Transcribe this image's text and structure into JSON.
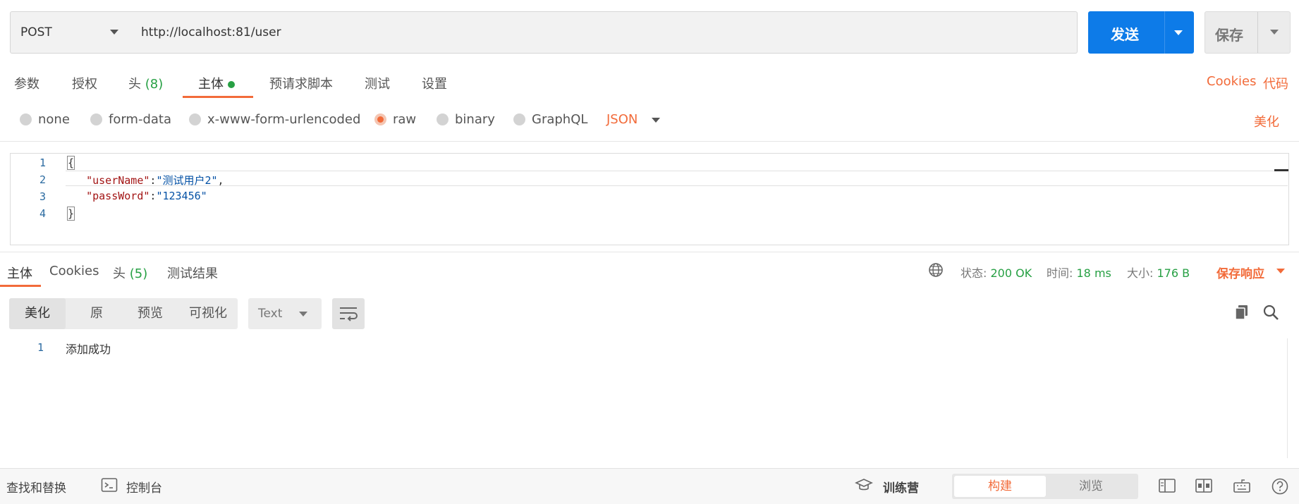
{
  "request": {
    "method": "POST",
    "url": "http://localhost:81/user",
    "send_label": "发送",
    "save_label": "保存"
  },
  "request_tabs": [
    {
      "label": "参数"
    },
    {
      "label": "授权"
    },
    {
      "label": "头",
      "count": "(8)"
    },
    {
      "label": "主体",
      "active": true
    },
    {
      "label": "预请求脚本"
    },
    {
      "label": "测试"
    },
    {
      "label": "设置"
    }
  ],
  "request_links": {
    "cookies": "Cookies",
    "code": "代码"
  },
  "body_types": [
    {
      "label": "none",
      "selected": false
    },
    {
      "label": "form-data",
      "selected": false
    },
    {
      "label": "x-www-form-urlencoded",
      "selected": false
    },
    {
      "label": "raw",
      "selected": true
    },
    {
      "label": "binary",
      "selected": false
    },
    {
      "label": "GraphQL",
      "selected": false
    }
  ],
  "body_language": "JSON",
  "beautify_label": "美化",
  "editor": {
    "line_numbers": [
      "1",
      "2",
      "3",
      "4"
    ],
    "open_brace": "{",
    "close_brace": "}",
    "line2_key": "\"userName\"",
    "line2_colon": ":",
    "line2_value": "\"测试用户2\"",
    "line2_comma": ",",
    "line3_key": "\"passWord\"",
    "line3_colon": ":",
    "line3_value": "\"123456\""
  },
  "response_tabs": [
    {
      "label": "主体",
      "active": true
    },
    {
      "label": "Cookies"
    },
    {
      "label": "头",
      "count": "(5)"
    },
    {
      "label": "测试结果"
    }
  ],
  "response_meta": {
    "status_label": "状态:",
    "status_value": "200 OK",
    "time_label": "时间:",
    "time_value": "18 ms",
    "size_label": "大小:",
    "size_value": "176 B",
    "save_response": "保存响应"
  },
  "view_modes": [
    {
      "label": "美化",
      "active": true
    },
    {
      "label": "原"
    },
    {
      "label": "预览"
    },
    {
      "label": "可视化"
    }
  ],
  "format_select": "Text",
  "response_body": {
    "line_number": "1",
    "text": "添加成功"
  },
  "statusbar": {
    "find_replace": "查找和替换",
    "console": "控制台",
    "bootcamp": "训练营",
    "build": "构建",
    "browse": "浏览"
  },
  "colors": {
    "accent_orange": "#f26b3a",
    "send_blue": "#0d7be8",
    "success_green": "#27a044"
  }
}
